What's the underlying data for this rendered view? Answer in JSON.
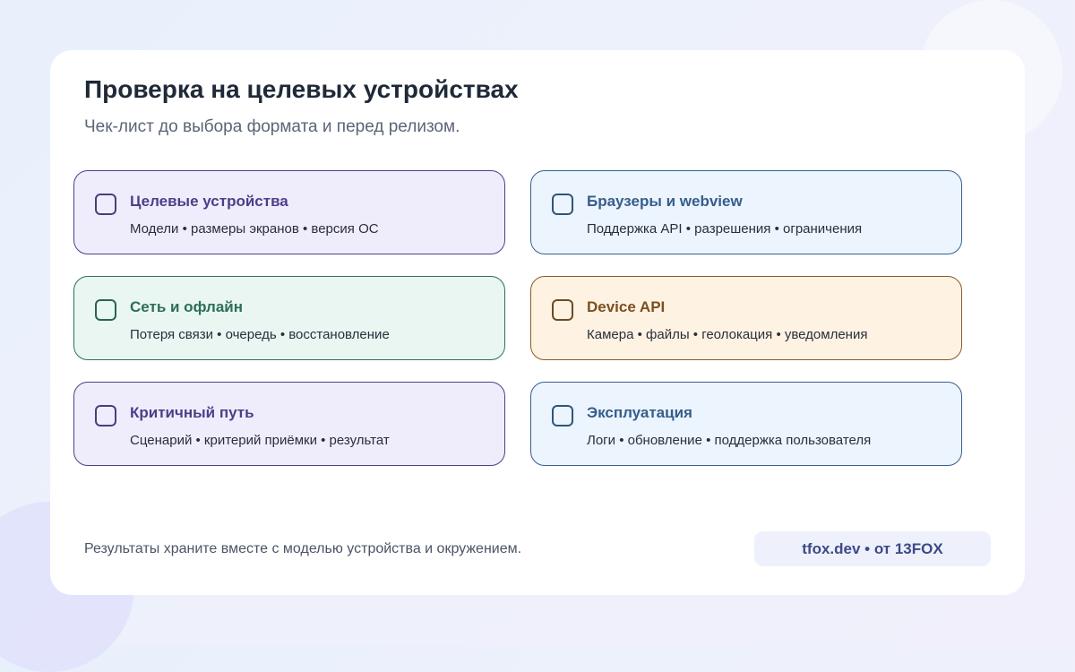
{
  "header": {
    "title": "Проверка на целевых устройствах",
    "subtitle": "Чек-лист до выбора формата и перед релизом."
  },
  "checklist": [
    {
      "title": "Целевые устройства",
      "description": "Модели • размеры экранов • версия ОС",
      "checked": false,
      "theme": "purple"
    },
    {
      "title": "Браузеры и webview",
      "description": "Поддержка API • разрешения • ограничения",
      "checked": false,
      "theme": "blue"
    },
    {
      "title": "Сеть и офлайн",
      "description": "Потеря связи • очередь • восстановление",
      "checked": false,
      "theme": "green"
    },
    {
      "title": "Device API",
      "description": "Камера • файлы • геолокация • уведомления",
      "checked": false,
      "theme": "orange"
    },
    {
      "title": "Критичный путь",
      "description": "Сценарий • критерий приёмки • результат",
      "checked": false,
      "theme": "purple"
    },
    {
      "title": "Эксплуатация",
      "description": "Логи • обновление • поддержка пользователя",
      "checked": false,
      "theme": "blue"
    }
  ],
  "footer": {
    "note": "Результаты храните вместе с моделью устройства и окружением.",
    "brand": "tfox.dev • от 13FOX"
  },
  "colors": {
    "purple_bg": "#efedfc",
    "purple_accent": "#4e3e88",
    "blue_bg": "#ecf4fd",
    "blue_accent": "#365d8c",
    "green_bg": "#e9f6f2",
    "green_accent": "#2c6e57",
    "orange_bg": "#fef2e3",
    "orange_accent": "#7b5020"
  }
}
